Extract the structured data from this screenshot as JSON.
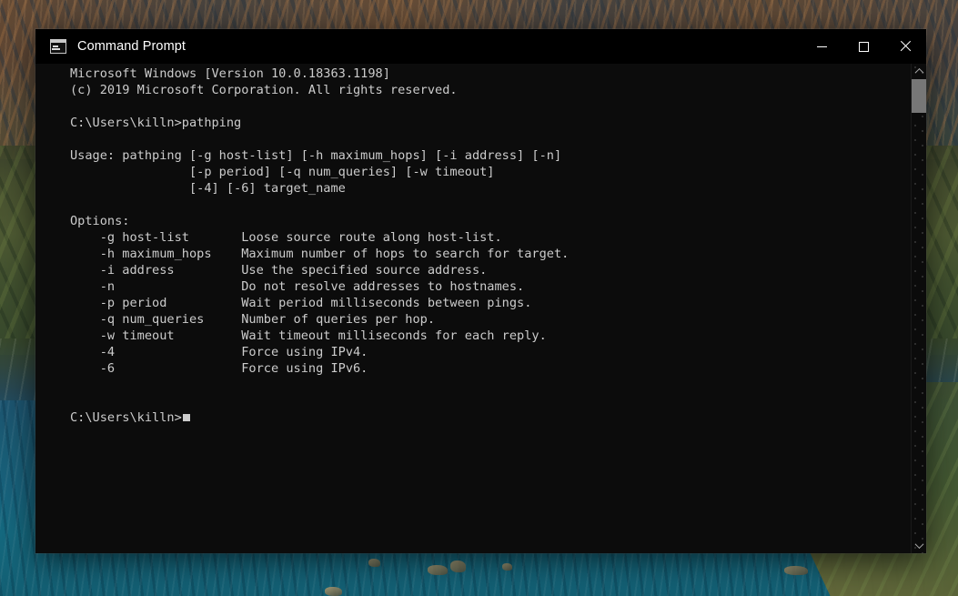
{
  "desktop": {
    "wallpaper_name": "coastal-mountain-wallpaper",
    "colors": {
      "mountain": "#4d4034",
      "hills": "#4e5a33",
      "ocean": "#18627c",
      "ocean_highlight": "#1abeb4"
    }
  },
  "window": {
    "title": "Command Prompt",
    "icon": "console-icon",
    "colors": {
      "titlebar_bg": "#000000",
      "console_bg": "#0c0c0c",
      "console_fg": "#cccccc",
      "scrollbar_thumb": "#777777",
      "close_hover": "#e81123"
    },
    "controls": {
      "minimize": "minimize-button",
      "maximize": "maximize-button",
      "close": "close-button"
    },
    "scrollbar": {
      "up_arrow": "scroll-up-arrow",
      "down_arrow": "scroll-down-arrow",
      "thumb": "scrollbar-thumb"
    }
  },
  "terminal": {
    "lines": [
      "Microsoft Windows [Version 10.0.18363.1198]",
      "(c) 2019 Microsoft Corporation. All rights reserved.",
      "",
      "C:\\Users\\killn>pathping",
      "",
      "Usage: pathping [-g host-list] [-h maximum_hops] [-i address] [-n]",
      "                [-p period] [-q num_queries] [-w timeout]",
      "                [-4] [-6] target_name",
      "",
      "Options:",
      "    -g host-list       Loose source route along host-list.",
      "    -h maximum_hops    Maximum number of hops to search for target.",
      "    -i address         Use the specified source address.",
      "    -n                 Do not resolve addresses to hostnames.",
      "    -p period          Wait period milliseconds between pings.",
      "    -q num_queries     Number of queries per hop.",
      "    -w timeout         Wait timeout milliseconds for each reply.",
      "    -4                 Force using IPv4.",
      "    -6                 Force using IPv6.",
      "",
      ""
    ],
    "prompt": "C:\\Users\\killn>",
    "cursor": "block-cursor"
  }
}
